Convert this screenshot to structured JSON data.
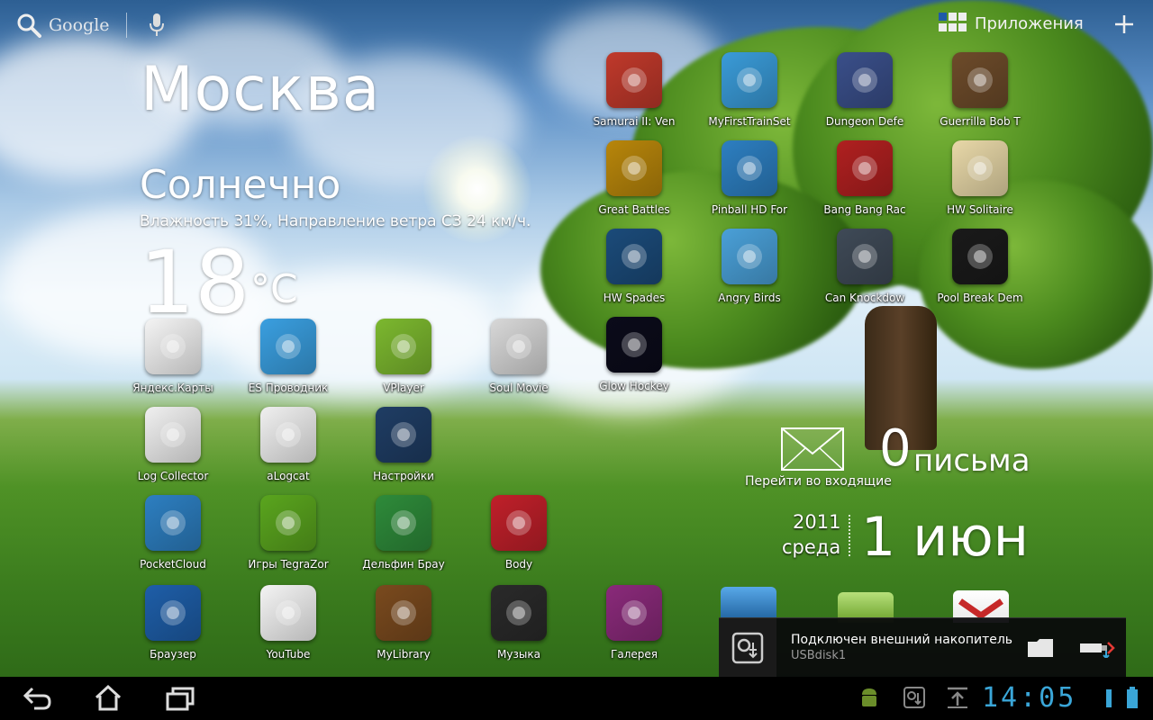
{
  "topbar": {
    "search_label": "Google",
    "apps_label": "Приложения"
  },
  "weather": {
    "city": "Москва",
    "condition": "Солнечно",
    "details": "Влажность 31%, Направление ветра СЗ 24 км/ч.",
    "temperature": "18",
    "unit": "°C"
  },
  "grid_apps": [
    {
      "label": "Samurai II: Ven",
      "color": "#c0392b",
      "icon": "samurai-game-icon"
    },
    {
      "label": "MyFirstTrainSet",
      "color": "#3a9bd8",
      "icon": "train-set-icon"
    },
    {
      "label": "Dungeon Defe",
      "color": "#3a4f8a",
      "icon": "dungeon-defenders-icon"
    },
    {
      "label": "Guerrilla Bob T",
      "color": "#6d4b2a",
      "icon": "guerrilla-bob-icon"
    },
    {
      "label": "Great Battles",
      "color": "#b8860b",
      "icon": "history-channel-icon"
    },
    {
      "label": "Pinball HD For",
      "color": "#2d7fc1",
      "icon": "pinball-icon"
    },
    {
      "label": "Bang Bang Rac",
      "color": "#b02020",
      "icon": "racing-car-icon"
    },
    {
      "label": "HW Solitaire",
      "color": "#e8d8a8",
      "icon": "solitaire-icon"
    },
    {
      "label": "HW Spades",
      "color": "#1b4b7a",
      "icon": "spades-icon"
    },
    {
      "label": "Angry Birds",
      "color": "#4aa0d8",
      "icon": "angry-birds-icon"
    },
    {
      "label": "Can Knockdow",
      "color": "#3f4a57",
      "icon": "can-knockdown-icon"
    },
    {
      "label": "Pool Break Dem",
      "color": "#1a1a1a",
      "icon": "pool-ball-icon"
    },
    {
      "label": "Glow Hockey",
      "color": "#0b0b1a",
      "icon": "glow-hockey-icon"
    }
  ],
  "dock_apps": [
    {
      "label": "Яндекс.Карты",
      "color": "#f4f4f4",
      "icon": "yandex-maps-icon"
    },
    {
      "label": "ES Проводник",
      "color": "#3a9fe0",
      "icon": "es-explorer-icon"
    },
    {
      "label": "VPlayer",
      "color": "#7cb82f",
      "icon": "vplayer-icon"
    },
    {
      "label": "Soul Movie",
      "color": "#d8d8d8",
      "icon": "film-reel-icon"
    },
    {
      "label": "Log Collector",
      "color": "#f0f0f0",
      "icon": "log-collector-icon"
    },
    {
      "label": "aLogcat",
      "color": "#f0f0f0",
      "icon": "alogcat-icon"
    },
    {
      "label": "Настройки",
      "color": "#1f3d64",
      "icon": "settings-icon"
    },
    {
      "label": "PocketCloud",
      "color": "#2d7fc1",
      "icon": "pocketcloud-icon"
    },
    {
      "label": "Игры TegraZor",
      "color": "#5aa51e",
      "icon": "nvidia-tegra-icon"
    },
    {
      "label": "Дельфин Брау",
      "color": "#2e8b3a",
      "icon": "dolphin-browser-icon"
    },
    {
      "label": "Body",
      "color": "#c0202a",
      "icon": "heart-icon"
    },
    {
      "label": "Браузер",
      "color": "#1e5ea8",
      "icon": "globe-browser-icon"
    },
    {
      "label": "YouTube",
      "color": "#f4f4f4",
      "icon": "youtube-icon"
    },
    {
      "label": "MyLibrary",
      "color": "#7a4a1e",
      "icon": "book-icon"
    },
    {
      "label": "Музыка",
      "color": "#2a2a2a",
      "icon": "headphones-icon"
    },
    {
      "label": "Галерея",
      "color": "#8a2a7a",
      "icon": "gallery-icon"
    }
  ],
  "mail": {
    "count": "0",
    "word": "письма",
    "link": "Перейти во входящие"
  },
  "date": {
    "year": "2011",
    "weekday": "среда",
    "day_month": "1 июн"
  },
  "notification": {
    "title": "Подключен внешний накопитель",
    "subtitle": "USBdisk1"
  },
  "statusbar": {
    "clock": "14:05"
  },
  "theme": {
    "clock_color": "#3aa6d8"
  }
}
